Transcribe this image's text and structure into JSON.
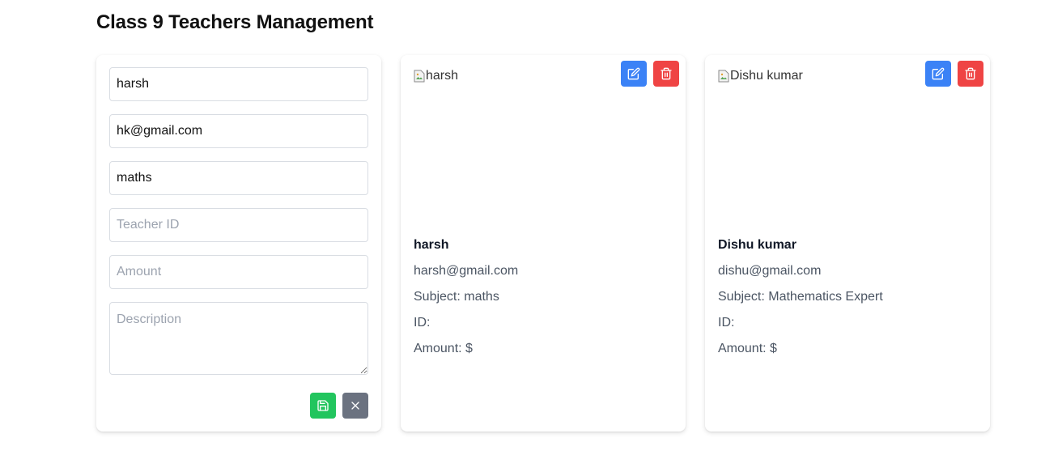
{
  "page": {
    "title": "Class 9 Teachers Management"
  },
  "form": {
    "name_value": "harsh",
    "email_value": "hk@gmail.com",
    "subject_value": "maths",
    "teacher_id_value": "",
    "teacher_id_placeholder": "Teacher ID",
    "amount_value": "",
    "amount_placeholder": "Amount",
    "description_value": "",
    "description_placeholder": "Description",
    "save_icon": "save-icon",
    "cancel_icon": "close-icon"
  },
  "teachers": [
    {
      "image_alt": "harsh",
      "name": "harsh",
      "email": "harsh@gmail.com",
      "subject": "Subject: maths",
      "id": "ID:",
      "amount": "Amount: $"
    },
    {
      "image_alt": "Dishu kumar",
      "name": "Dishu kumar",
      "email": "dishu@gmail.com",
      "subject": "Subject: Mathematics Expert",
      "id": "ID:",
      "amount": "Amount: $"
    }
  ],
  "colors": {
    "save": "#22c55e",
    "cancel": "#6b7280",
    "edit": "#3b82f6",
    "delete": "#ef4444"
  }
}
